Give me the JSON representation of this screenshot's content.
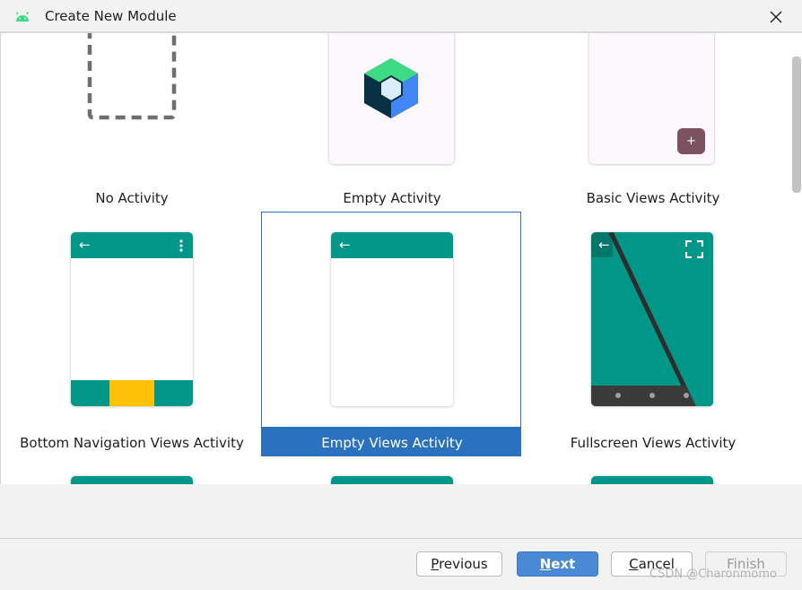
{
  "window": {
    "title": "Create New Module",
    "accent": "#2a72c0",
    "teal": "#009688"
  },
  "templates": [
    {
      "label": "No Activity",
      "icon": "dashed-square-icon"
    },
    {
      "label": "Empty Activity",
      "icon": "compose-hexagon-icon"
    },
    {
      "label": "Basic Views Activity",
      "icon": "fab-plus-icon",
      "fab_symbol": "+"
    },
    {
      "label": "Bottom Navigation Views Activity",
      "icon": "bottom-nav-preview"
    },
    {
      "label": "Empty Views Activity",
      "icon": "appbar-preview",
      "selected": true
    },
    {
      "label": "Fullscreen Views Activity",
      "icon": "fullscreen-preview"
    }
  ],
  "footer": {
    "previous_prefix": "",
    "previous_mnemonic": "P",
    "previous_rest": "revious",
    "next_mnemonic": "N",
    "next_rest": "ext",
    "cancel_mnemonic": "C",
    "cancel_rest": "ancel",
    "finish_label": "Finish",
    "watermark": "CSDN @Charonmomo"
  }
}
